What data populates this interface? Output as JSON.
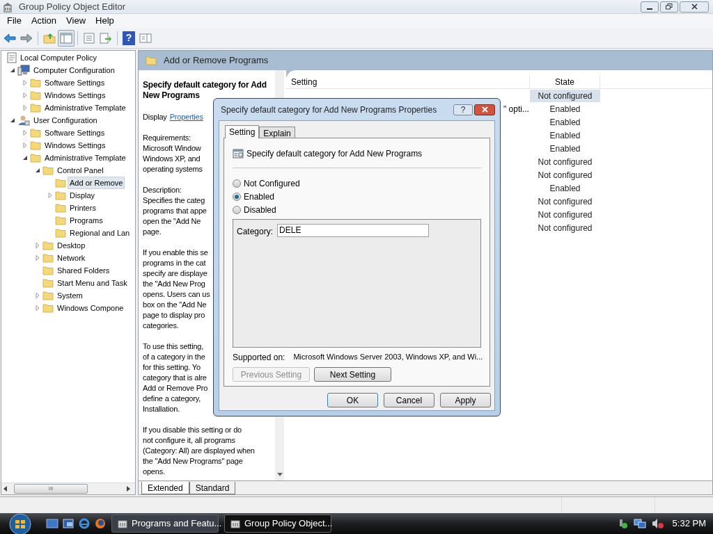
{
  "window": {
    "title": "Group Policy Object Editor"
  },
  "menu": [
    "File",
    "Action",
    "View",
    "Help"
  ],
  "toolbar": [
    {
      "kind": "back",
      "pressed": false
    },
    {
      "kind": "forward",
      "pressed": false
    },
    {
      "kind": "sep"
    },
    {
      "kind": "up",
      "pressed": false
    },
    {
      "kind": "tree",
      "pressed": true
    },
    {
      "kind": "sep"
    },
    {
      "kind": "list",
      "pressed": false
    },
    {
      "kind": "export",
      "pressed": false
    },
    {
      "kind": "sep"
    },
    {
      "kind": "help",
      "pressed": false,
      "label": "?"
    },
    {
      "kind": "pane",
      "pressed": false
    }
  ],
  "tree": [
    {
      "label": "Local Computer Policy",
      "kind": "policy",
      "selected": false,
      "children": [
        {
          "label": "Computer Configuration",
          "kind": "computer",
          "expanded": true,
          "selected": false,
          "children": [
            {
              "label": "Software Settings",
              "kind": "folder",
              "expanded": false,
              "selected": false
            },
            {
              "label": "Windows Settings",
              "kind": "folder",
              "expanded": false,
              "selected": false
            },
            {
              "label": "Administrative Template",
              "kind": "folder",
              "expanded": false,
              "selected": false
            }
          ]
        },
        {
          "label": "User Configuration",
          "kind": "user",
          "expanded": true,
          "selected": false,
          "children": [
            {
              "label": "Software Settings",
              "kind": "folder",
              "expanded": false,
              "selected": false
            },
            {
              "label": "Windows Settings",
              "kind": "folder",
              "expanded": false,
              "selected": false
            },
            {
              "label": "Administrative Template",
              "kind": "folder",
              "expanded": true,
              "selected": false,
              "children": [
                {
                  "label": "Control Panel",
                  "kind": "folder",
                  "expanded": true,
                  "selected": false,
                  "children": [
                    {
                      "label": "Add or Remove",
                      "kind": "folder",
                      "selected": true
                    },
                    {
                      "label": "Display",
                      "kind": "folder",
                      "expanded": false,
                      "selected": false
                    },
                    {
                      "label": "Printers",
                      "kind": "folder",
                      "selected": false
                    },
                    {
                      "label": "Programs",
                      "kind": "folder",
                      "selected": false
                    },
                    {
                      "label": "Regional and Lan",
                      "kind": "folder",
                      "selected": false
                    }
                  ]
                },
                {
                  "label": "Desktop",
                  "kind": "folder",
                  "expanded": false,
                  "selected": false
                },
                {
                  "label": "Network",
                  "kind": "folder",
                  "expanded": false,
                  "selected": false
                },
                {
                  "label": "Shared Folders",
                  "kind": "folder",
                  "selected": false
                },
                {
                  "label": "Start Menu and Task",
                  "kind": "folder",
                  "selected": false
                },
                {
                  "label": "System",
                  "kind": "folder",
                  "expanded": false,
                  "selected": false
                },
                {
                  "label": "Windows Compone",
                  "kind": "folder",
                  "expanded": false,
                  "selected": false
                }
              ]
            }
          ]
        }
      ]
    }
  ],
  "tree_scrollbar": {
    "grip": "III"
  },
  "details": {
    "header": "Add or Remove Programs",
    "title": "Specify default category for Add New Programs",
    "display_label": "Display",
    "display_link": "Properties",
    "paragraphs": [
      [
        "Requirements:",
        "Microsoft Window",
        "Windows XP, and",
        "operating systems"
      ],
      [
        "Description:",
        "Specifies the categ",
        "programs that appe",
        "open the \"Add Ne",
        "page."
      ],
      [
        "If you enable this se",
        "programs in the cat",
        "specify are displaye",
        "the \"Add New Prog",
        "opens. Users can us",
        "box on the \"Add Ne",
        "page to display pro",
        "categories."
      ],
      [
        "To use this setting,",
        "of a category in the",
        "for this setting. Yo",
        "category that is alre",
        "Add or Remove Pro",
        "define a category,",
        "Installation."
      ],
      [
        "If you disable this setting or do",
        "not configure it, all programs",
        "(Category: All) are displayed when",
        "the \"Add New Programs\" page",
        "opens."
      ]
    ]
  },
  "list": {
    "columns": [
      "Setting",
      "State"
    ],
    "rows": [
      {
        "state": "Not configured",
        "selected": true
      },
      {
        "setting": "\" opti...",
        "state": "Enabled",
        "selected": false
      },
      {
        "state": "Enabled",
        "selected": false
      },
      {
        "state": "Enabled",
        "selected": false
      },
      {
        "state": "Enabled",
        "selected": false
      },
      {
        "state": "Not configured",
        "selected": false
      },
      {
        "state": "Not configured",
        "selected": false
      },
      {
        "state": "Enabled",
        "selected": false
      },
      {
        "state": "Not configured",
        "selected": false
      },
      {
        "state": "Not configured",
        "selected": false
      },
      {
        "state": "Not configured",
        "selected": false
      }
    ]
  },
  "view_tabs": [
    {
      "label": "Extended",
      "selected": true
    },
    {
      "label": "Standard",
      "selected": false
    }
  ],
  "dialog": {
    "title": "Specify default category for Add New Programs Properties",
    "help": "?",
    "tabs": [
      {
        "label": "Setting",
        "selected": true
      },
      {
        "label": "Explain",
        "selected": false
      }
    ],
    "policy_name": "Specify default category for Add New Programs",
    "options": [
      {
        "label": "Not Configured",
        "selected": false
      },
      {
        "label": "Enabled",
        "selected": true
      },
      {
        "label": "Disabled",
        "selected": false
      }
    ],
    "category_label": "Category:",
    "category_value": "DELE",
    "supported_label": "Supported on:",
    "supported_value": "Microsoft Windows Server 2003, Windows XP, and Wi...",
    "nav_buttons": [
      {
        "label": "Previous Setting",
        "disabled": true
      },
      {
        "label": "Next Setting",
        "disabled": false
      }
    ],
    "buttons": [
      {
        "label": "OK",
        "default": true
      },
      {
        "label": "Cancel",
        "default": false
      },
      {
        "label": "Apply",
        "default": false
      }
    ]
  },
  "taskbar": {
    "buttons": [
      {
        "label": "Programs and Featu...",
        "selected": false
      },
      {
        "label": "Group Policy Object...",
        "selected": true
      }
    ],
    "clock": "5:32 PM"
  }
}
